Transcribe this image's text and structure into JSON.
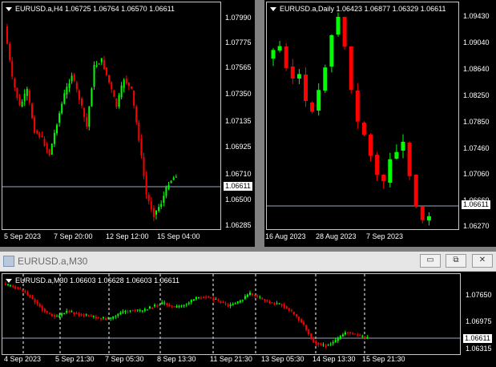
{
  "charts": {
    "h4": {
      "legend": "EURUSD.a,H4  1.06725 1.06764 1.06570 1.06611",
      "price_label": "1.06611",
      "y_labels": [
        "1.07990",
        "1.07775",
        "1.07565",
        "1.07350",
        "1.07135",
        "1.06925",
        "1.06710",
        "1.06500",
        "1.06285"
      ],
      "x_labels": [
        "5 Sep 2023",
        "7 Sep 20:00",
        "12 Sep 12:00",
        "15 Sep 04:00"
      ]
    },
    "daily": {
      "legend": "EURUSD.a,Daily  1.06423 1.06877 1.06329 1.06611",
      "price_label": "1.06611",
      "y_labels": [
        "1.09430",
        "1.09040",
        "1.08640",
        "1.08250",
        "1.07850",
        "1.07460",
        "1.07060",
        "1.06660",
        "1.06270"
      ],
      "x_labels": [
        "16 Aug 2023",
        "28 Aug 2023",
        "7 Sep 2023"
      ]
    },
    "m30": {
      "window_title": "EURUSD.a,M30",
      "legend": "EURUSD.a,M30  1.06603 1.06628 1.06603 1.06611",
      "price_label": "1.06611",
      "y_labels": [
        "1.07650",
        "1.06975",
        "1.06315"
      ],
      "x_labels": [
        "4 Sep 2023",
        "5 Sep 21:30",
        "7 Sep 05:30",
        "8 Sep 13:30",
        "11 Sep 21:30",
        "13 Sep 05:30",
        "14 Sep 13:30",
        "15 Sep 21:30"
      ]
    }
  },
  "colors": {
    "bull": "#00ff00",
    "bear": "#ff0000",
    "grid": "#ffffff",
    "priceline": "#9aa7c0"
  },
  "window_buttons": {
    "minimize": "▭",
    "restore": "⧉",
    "close": "✕"
  }
}
